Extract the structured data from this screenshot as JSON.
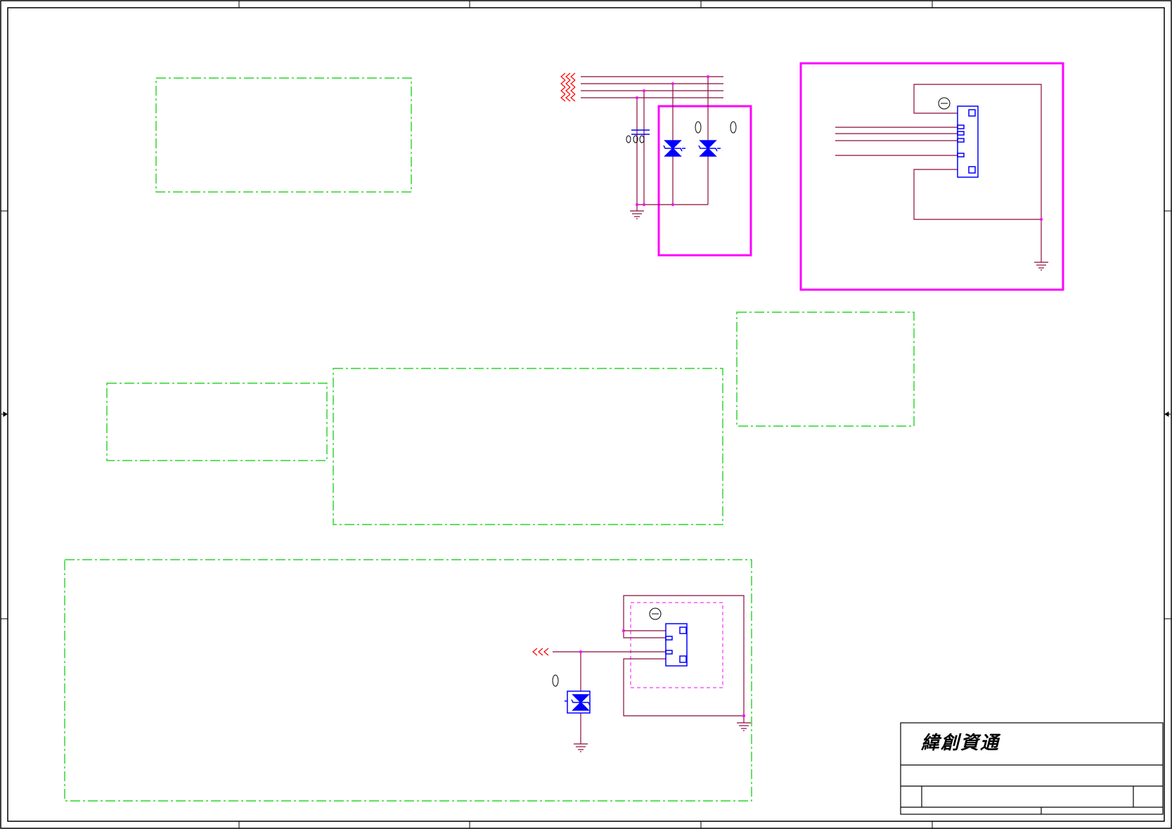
{
  "title_block": {
    "company": "緯創資通"
  },
  "colors": {
    "border": "#000000",
    "wire": "#8b0a3c",
    "net_label": "#ff0000",
    "component": "#0000ff",
    "junction": "#ff00ff",
    "group_box": "#ff00ff",
    "note_box": "#00cc00",
    "ground": "#8b0a3c"
  },
  "icons": {
    "ground": "ground-icon",
    "tvs": "tvs-diode-icon",
    "connector": "connector-icon",
    "capacitor": "capacitor-icon"
  }
}
